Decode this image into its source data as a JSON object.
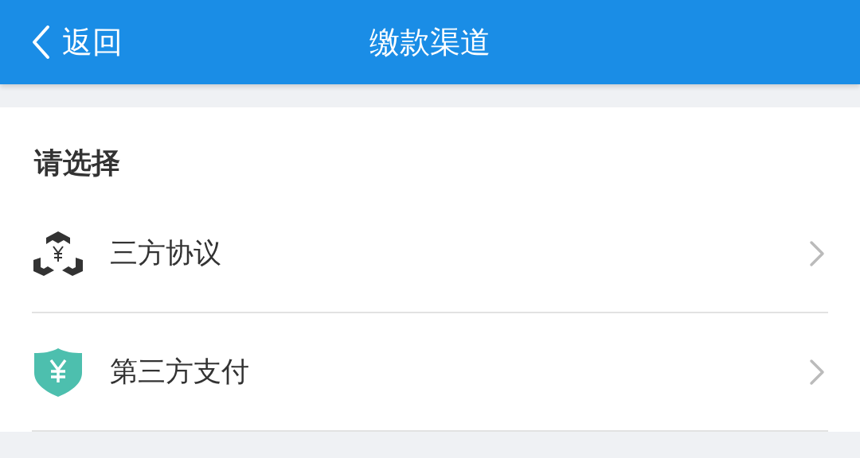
{
  "header": {
    "back": "返回",
    "title": "缴款渠道"
  },
  "section": {
    "heading": "请选择",
    "items": [
      {
        "kind": "agreement",
        "label": "三方协议"
      },
      {
        "kind": "shield",
        "label": "第三方支付"
      }
    ]
  }
}
